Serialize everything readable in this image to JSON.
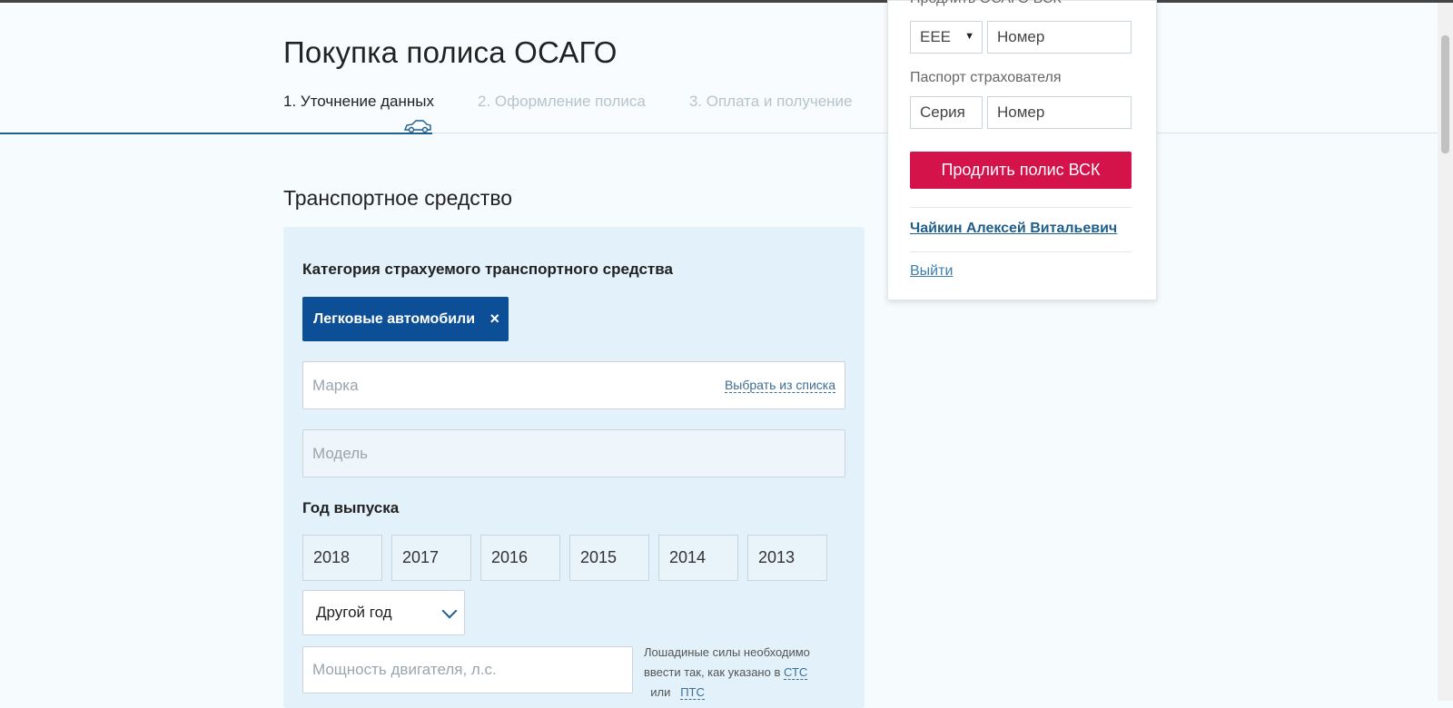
{
  "header": {
    "title": "Покупка полиса ОСАГО",
    "steps": [
      {
        "label": "1. Уточнение данных"
      },
      {
        "label": "2. Оформление полиса"
      },
      {
        "label": "3. Оплата и получение"
      }
    ]
  },
  "vehicle": {
    "section_title": "Транспортное средство",
    "category_label": "Категория страхуемого транспортного средства",
    "category_chip": "Легковые автомобили",
    "chip_close": "×",
    "brand_placeholder": "Марка",
    "brand_link": "Выбрать из списка",
    "model_placeholder": "Модель",
    "year_label": "Год выпуска",
    "years": [
      "2018",
      "2017",
      "2016",
      "2015",
      "2014",
      "2013"
    ],
    "other_year": "Другой год",
    "power_placeholder": "Мощность двигателя, л.с.",
    "power_hint_1": "Лошадиные силы необходимо ввести так, как указано в",
    "power_hint_link1": "СТС",
    "power_hint_2": "или",
    "power_hint_link2": "ПТС"
  },
  "panel": {
    "renew_heading": "Продлить ОСАГО ВСК",
    "series_value": "ЕЕЕ",
    "policy_number_placeholder": "Номер",
    "passport_label": "Паспорт страхователя",
    "passport_series_placeholder": "Серия",
    "passport_number_placeholder": "Номер",
    "renew_button": "Продлить полис ВСК",
    "user_name": "Чайкин Алексей Витальевич",
    "logout": "Выйти"
  },
  "colors": {
    "accent": "#0d4f97",
    "renew": "#d5134b",
    "link": "#1f5f8a"
  }
}
